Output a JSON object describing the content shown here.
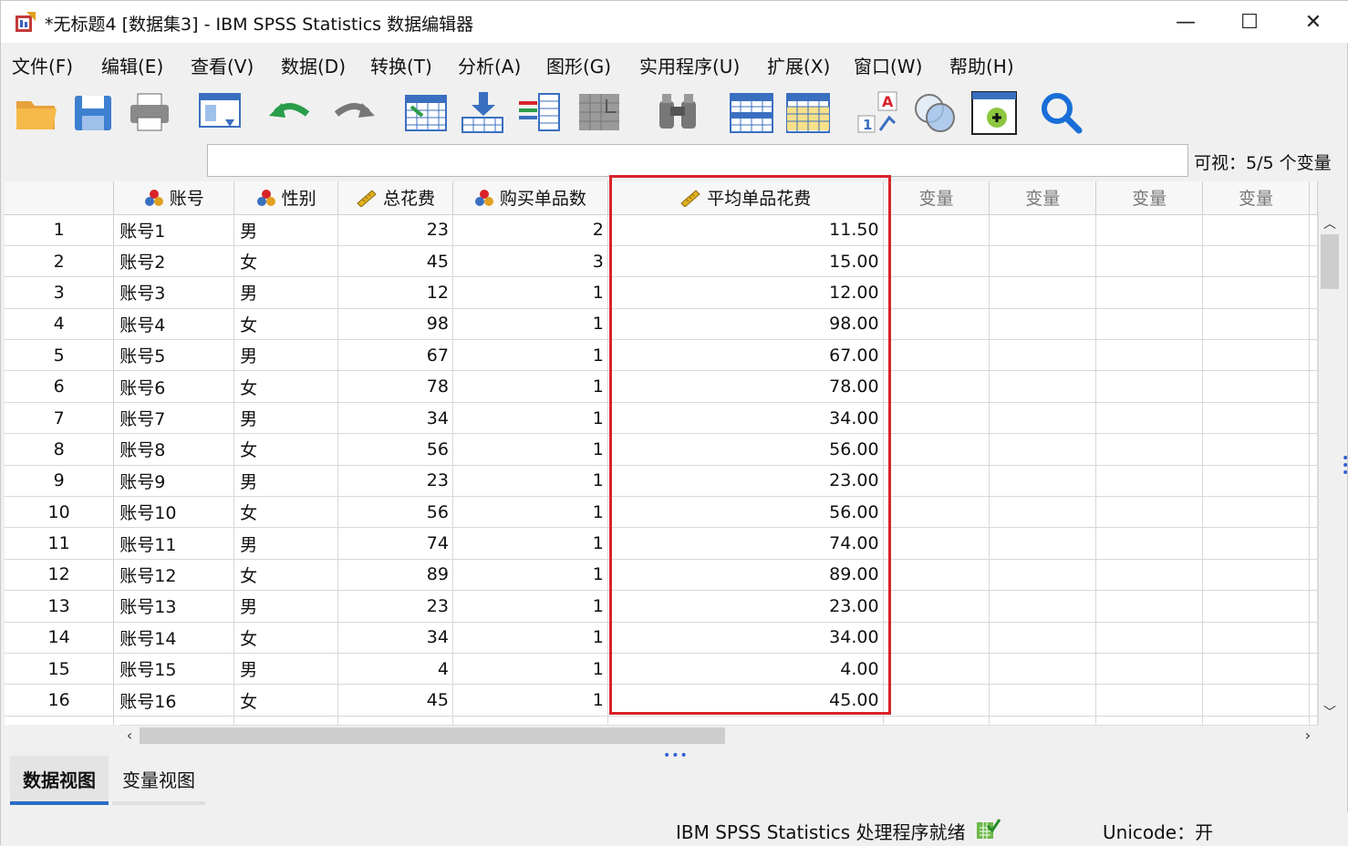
{
  "window": {
    "title": "*无标题4 [数据集3] - IBM SPSS Statistics 数据编辑器",
    "minimize": "—",
    "maximize": "☐",
    "close": "✕"
  },
  "menu": [
    "文件(F)",
    "编辑(E)",
    "查看(V)",
    "数据(D)",
    "转换(T)",
    "分析(A)",
    "图形(G)",
    "实用程序(U)",
    "扩展(X)",
    "窗口(W)",
    "帮助(H)"
  ],
  "toolbar_icons": [
    "open-folder-icon",
    "save-icon",
    "print-icon",
    "recall-dialog-icon",
    "undo-icon",
    "redo-icon",
    "goto-case-icon",
    "goto-variable-icon",
    "variables-icon",
    "run-descriptives-icon",
    "find-icon",
    "insert-cases-icon",
    "insert-variable-icon",
    "split-file-icon",
    "select-cases-icon",
    "value-labels-icon",
    "search-icon"
  ],
  "visible_label": "可视：5/5 个变量",
  "columns": [
    {
      "name": "账号",
      "icon": "nominal-icon",
      "align": "left"
    },
    {
      "name": "性别",
      "icon": "nominal-icon",
      "align": "left"
    },
    {
      "name": "总花费",
      "icon": "scale-icon",
      "align": "right"
    },
    {
      "name": "购买单品数",
      "icon": "nominal-icon",
      "align": "right"
    },
    {
      "name": "平均单品花费",
      "icon": "scale-icon",
      "align": "right"
    }
  ],
  "empty_column_label": "变量",
  "rows": [
    [
      "账号1",
      "男",
      "23",
      "2",
      "11.50"
    ],
    [
      "账号2",
      "女",
      "45",
      "3",
      "15.00"
    ],
    [
      "账号3",
      "男",
      "12",
      "1",
      "12.00"
    ],
    [
      "账号4",
      "女",
      "98",
      "1",
      "98.00"
    ],
    [
      "账号5",
      "男",
      "67",
      "1",
      "67.00"
    ],
    [
      "账号6",
      "女",
      "78",
      "1",
      "78.00"
    ],
    [
      "账号7",
      "男",
      "34",
      "1",
      "34.00"
    ],
    [
      "账号8",
      "女",
      "56",
      "1",
      "56.00"
    ],
    [
      "账号9",
      "男",
      "23",
      "1",
      "23.00"
    ],
    [
      "账号10",
      "女",
      "56",
      "1",
      "56.00"
    ],
    [
      "账号11",
      "男",
      "74",
      "1",
      "74.00"
    ],
    [
      "账号12",
      "女",
      "89",
      "1",
      "89.00"
    ],
    [
      "账号13",
      "男",
      "23",
      "1",
      "23.00"
    ],
    [
      "账号14",
      "女",
      "34",
      "1",
      "34.00"
    ],
    [
      "账号15",
      "男",
      "4",
      "1",
      "4.00"
    ],
    [
      "账号16",
      "女",
      "45",
      "1",
      "45.00"
    ]
  ],
  "tabs": {
    "data_view": "数据视图",
    "variable_view": "变量视图"
  },
  "status": {
    "processor": "IBM SPSS Statistics 处理程序就绪",
    "unicode": "Unicode：开"
  },
  "colors": {
    "highlight": "#d9232a",
    "active_tab_underline": "#2b6cc4"
  }
}
